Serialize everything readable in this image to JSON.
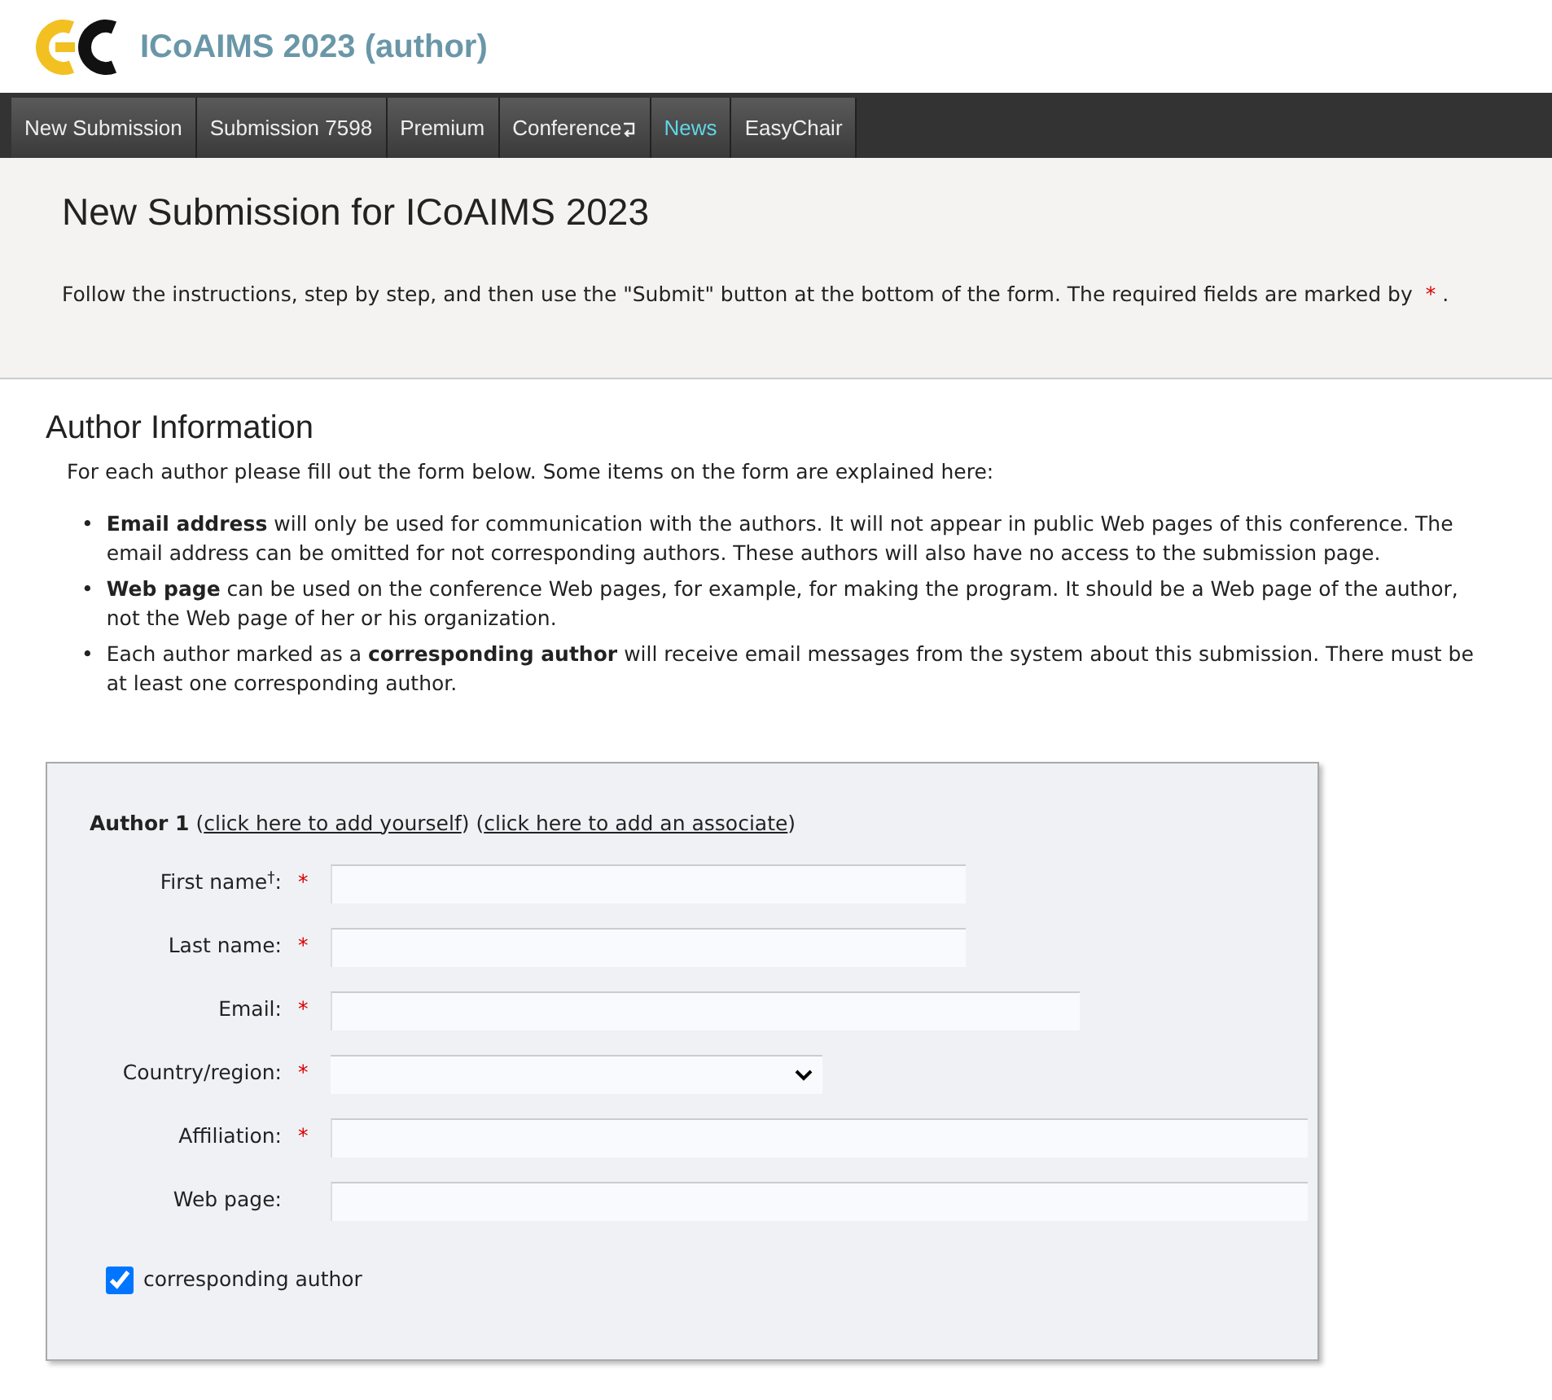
{
  "header": {
    "title": "ICoAIMS 2023 (author)"
  },
  "nav": [
    {
      "label": "New Submission",
      "selected": false,
      "kind": "link"
    },
    {
      "label": "Submission 7598",
      "selected": false,
      "kind": "link"
    },
    {
      "label": "Premium",
      "selected": false,
      "kind": "link"
    },
    {
      "label": "Conference",
      "selected": false,
      "kind": "menu"
    },
    {
      "label": "News",
      "selected": true,
      "kind": "link"
    },
    {
      "label": "EasyChair",
      "selected": false,
      "kind": "link"
    }
  ],
  "intro": {
    "title": "New Submission for ICoAIMS 2023",
    "text": "Follow the instructions, step by step, and then use the \"Submit\" button at the bottom of the form. The required fields are marked by",
    "mark": "*",
    "end": "."
  },
  "section": {
    "title": "Author Information",
    "lead": "For each author please fill out the form below. Some items on the form are explained here:",
    "bullets": [
      {
        "marker": "•",
        "text": "**Email address** will only be used for communication with the authors. It will not appear in public Web pages of this conference. The email address can be omitted for not corresponding authors. These authors will also have no access to the submission page."
      },
      {
        "marker": "•",
        "text": "**Web page** can be used on the conference Web pages, for example, for making the program. It should be a Web page of the author, not the Web page of her or his organization."
      },
      {
        "marker": "•",
        "text": "Each author marked as a **corresponding author** will receive email messages from the system about this submission. There must be at least one corresponding author."
      }
    ]
  },
  "author": {
    "title": "Author 1",
    "open": "(",
    "close": ")",
    "links": [
      "click here to add yourself",
      "click here to add an associate"
    ],
    "fields": [
      {
        "label": "First name$^{†}$:",
        "kind": "text",
        "mark": "*"
      },
      {
        "label": "Last name:",
        "kind": "text",
        "mark": "*"
      },
      {
        "label": "Email:",
        "kind": "text",
        "mark": "*"
      },
      {
        "label": "Country/region:",
        "kind": "select",
        "mark": "*"
      },
      {
        "label": "Affiliation:",
        "kind": "text",
        "mark": "*"
      },
      {
        "label": "Web page:",
        "kind": "text"
      }
    ],
    "corresponding": {
      "label": "corresponding author",
      "checked": true
    }
  }
}
